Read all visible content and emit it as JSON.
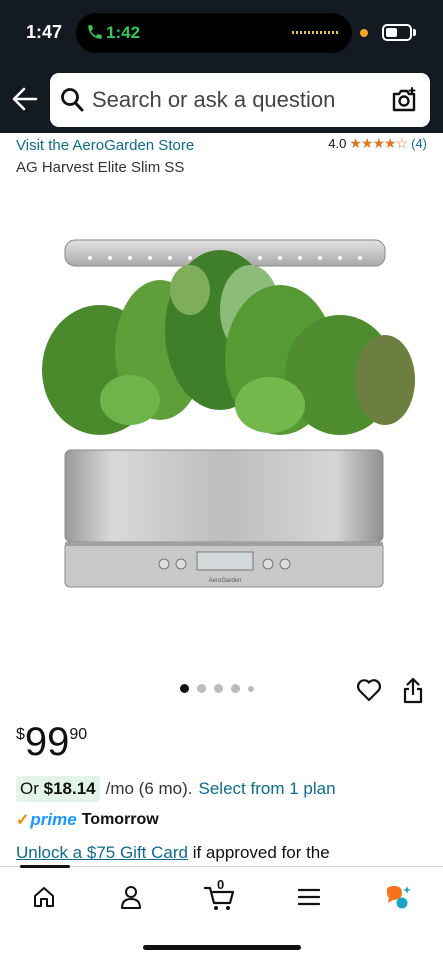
{
  "status_bar": {
    "time": "1:47",
    "call_time": "1:42"
  },
  "header": {
    "search_placeholder": "Search or ask a question",
    "icons": [
      "back-arrow-icon",
      "search-icon",
      "camera-search-icon"
    ]
  },
  "product": {
    "store_link": "Visit the AeroGarden Store",
    "rating_value": "4.0",
    "rating_stars": "★★★★☆",
    "rating_count": "(4)",
    "name": "AG Harvest Elite Slim SS",
    "image_brand": "AeroGarden",
    "image_count": 5,
    "active_image": 1
  },
  "price": {
    "symbol": "$",
    "whole": "99",
    "fraction": "90"
  },
  "financing": {
    "prefix": "Or ",
    "amount": "$18.14",
    "term": "/mo (6 mo).",
    "link": "Select from 1 plan"
  },
  "delivery": {
    "prime_check": "✓",
    "prime_word": "prime",
    "day": "Tomorrow"
  },
  "promo": {
    "link": "Unlock a $75 Gift Card",
    "text": " if approved for the"
  },
  "tabbar": {
    "items": [
      "home-icon",
      "account-icon",
      "cart-icon",
      "menu-icon",
      "rufus-icon"
    ],
    "cart_count": "0"
  },
  "colors": {
    "header_bg": "#131a22",
    "link": "#0f6b8c",
    "star": "#de7921",
    "prime": "#1a98ff",
    "prime_check": "#f08804",
    "monthly_badge_bg": "#e3f4e6",
    "call_green": "#34c759"
  }
}
